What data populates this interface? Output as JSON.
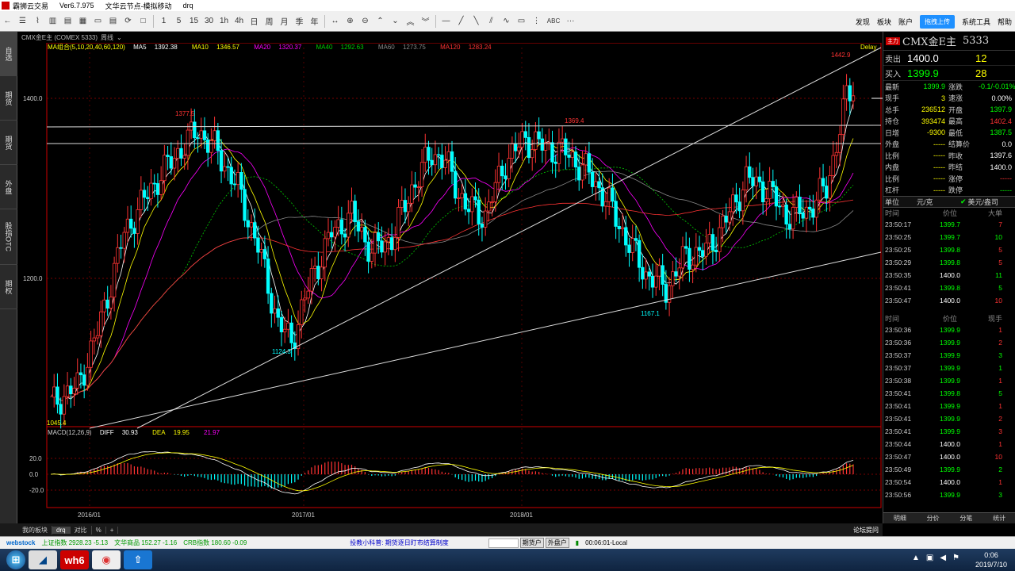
{
  "window": {
    "title": "霸狮云交易",
    "version": "Ver6.7.975",
    "node": "文华云节点-模拟移动",
    "user": "drq"
  },
  "toolbar": {
    "nums": [
      "1",
      "5",
      "15",
      "30",
      "1h",
      "4h",
      "日",
      "周",
      "月",
      "季",
      "年"
    ],
    "abc_label": "ABC",
    "more": "···"
  },
  "topmenu": {
    "items": [
      "发现",
      "板块",
      "账户",
      "系统工具",
      "帮助"
    ],
    "cloud": "拖拽上传"
  },
  "lefttabs": [
    "自选",
    "期货",
    "期货",
    "外盘",
    "股指OTC",
    "期权"
  ],
  "chart": {
    "instrument": "CMX金E主 (COMEX 5333)",
    "period": "周线",
    "ma_label": "MA组合(5,10,20,40,60,120)",
    "ma": [
      {
        "name": "MA5",
        "value": "1392.38",
        "color": "#ffffff"
      },
      {
        "name": "MA10",
        "value": "1346.57",
        "color": "#ffff00"
      },
      {
        "name": "MA20",
        "value": "1320.37",
        "color": "#ff00ff"
      },
      {
        "name": "MA40",
        "value": "1292.63",
        "color": "#00cc00"
      },
      {
        "name": "MA60",
        "value": "1273.75",
        "color": "#888888"
      },
      {
        "name": "MA120",
        "value": "1283.24",
        "color": "#ff3333"
      }
    ],
    "macd_label": "MACD(12,26,9)",
    "macd": [
      {
        "name": "DIFF",
        "value": "30.93"
      },
      {
        "name": "DEA",
        "value": "19.95"
      },
      {
        "name": "",
        "value": "21.97"
      }
    ],
    "annotations": {
      "high_right": "1442.9",
      "peak_2016": "1377.5",
      "peak_2018": "1369.4",
      "low_2016": "1124.3",
      "low_2018": "1167.1",
      "start_low": "1045.4",
      "delay": "Delay"
    },
    "y_labels": [
      "1400.0",
      "1200.0"
    ],
    "macd_y_labels": [
      "20.0",
      "0.0",
      "-20.0"
    ],
    "x_labels": [
      "2016/01",
      "2017/01",
      "2018/01"
    ],
    "colors": {
      "up": "#ff3333",
      "down": "#00ffff",
      "bg": "#000000"
    }
  },
  "quote": {
    "badge": "主力",
    "name": "CMX金E主",
    "code": "5333",
    "sell": {
      "label": "卖出",
      "price": "1400.0",
      "vol": "12"
    },
    "buy": {
      "label": "买入",
      "price": "1399.9",
      "vol": "28"
    },
    "rows": [
      {
        "l1": "最新",
        "v1": "1399.9",
        "c1": "#00ff00",
        "l2": "涨跌",
        "v2": "-0.1/-0.01%",
        "c2": "#00ff00"
      },
      {
        "l1": "现手",
        "v1": "3",
        "c1": "#ffff00",
        "l2": "速涨",
        "v2": "0.00%",
        "c2": "#ffffff"
      },
      {
        "l1": "总手",
        "v1": "236512",
        "c1": "#ffff00",
        "l2": "开盘",
        "v2": "1397.9",
        "c2": "#00ff00"
      },
      {
        "l1": "持仓",
        "v1": "393474",
        "c1": "#ffff00",
        "l2": "最高",
        "v2": "1402.4",
        "c2": "#ff3333"
      },
      {
        "l1": "日增",
        "v1": "-9300",
        "c1": "#ffff00",
        "l2": "最低",
        "v2": "1387.5",
        "c2": "#00ff00"
      },
      {
        "l1": "外盘",
        "v1": "-----",
        "c1": "#ffff00",
        "l2": "结算价",
        "v2": "0.0",
        "c2": "#ffffff"
      },
      {
        "l1": "比例",
        "v1": "-----",
        "c1": "#ffff00",
        "l2": "昨收",
        "v2": "1397.6",
        "c2": "#ffffff"
      },
      {
        "l1": "内盘",
        "v1": "-----",
        "c1": "#ffff00",
        "l2": "昨结",
        "v2": "1400.0",
        "c2": "#ffffff"
      },
      {
        "l1": "比例",
        "v1": "-----",
        "c1": "#ffff00",
        "l2": "涨停",
        "v2": "-----",
        "c2": "#ff3333"
      },
      {
        "l1": "杠杆",
        "v1": "-----",
        "c1": "#ffff00",
        "l2": "跌停",
        "v2": "-----",
        "c2": "#00ff00"
      }
    ],
    "unit": {
      "label": "单位",
      "value": "元/克",
      "alt": "美元/盎司"
    },
    "ticks1_head": [
      "时间",
      "价位",
      "大单"
    ],
    "ticks1": [
      {
        "t": "23:50:17",
        "p": "1399.7",
        "pc": "#00ff00",
        "v": "7",
        "vc": "#ff3333"
      },
      {
        "t": "23:50:25",
        "p": "1399.7",
        "pc": "#00ff00",
        "v": "10",
        "vc": "#00ff00"
      },
      {
        "t": "23:50:25",
        "p": "1399.8",
        "pc": "#00ff00",
        "v": "5",
        "vc": "#ff3333"
      },
      {
        "t": "23:50:29",
        "p": "1399.8",
        "pc": "#00ff00",
        "v": "5",
        "vc": "#ff3333"
      },
      {
        "t": "23:50:35",
        "p": "1400.0",
        "pc": "#ffffff",
        "v": "11",
        "vc": "#00ff00"
      },
      {
        "t": "23:50:41",
        "p": "1399.8",
        "pc": "#00ff00",
        "v": "5",
        "vc": "#00ff00"
      },
      {
        "t": "23:50:47",
        "p": "1400.0",
        "pc": "#ffffff",
        "v": "10",
        "vc": "#ff3333"
      }
    ],
    "ticks2_head": [
      "时间",
      "价位",
      "现手"
    ],
    "ticks2": [
      {
        "t": "23:50:36",
        "p": "1399.9",
        "pc": "#00ff00",
        "v": "1",
        "vc": "#ff3333"
      },
      {
        "t": "23:50:36",
        "p": "1399.9",
        "pc": "#00ff00",
        "v": "2",
        "vc": "#ff3333"
      },
      {
        "t": "23:50:37",
        "p": "1399.9",
        "pc": "#00ff00",
        "v": "3",
        "vc": "#00ff00"
      },
      {
        "t": "23:50:37",
        "p": "1399.9",
        "pc": "#00ff00",
        "v": "1",
        "vc": "#00ff00"
      },
      {
        "t": "23:50:38",
        "p": "1399.9",
        "pc": "#00ff00",
        "v": "1",
        "vc": "#ff3333"
      },
      {
        "t": "23:50:41",
        "p": "1399.8",
        "pc": "#00ff00",
        "v": "5",
        "vc": "#00ff00"
      },
      {
        "t": "23:50:41",
        "p": "1399.9",
        "pc": "#00ff00",
        "v": "1",
        "vc": "#ff3333"
      },
      {
        "t": "23:50:41",
        "p": "1399.9",
        "pc": "#00ff00",
        "v": "2",
        "vc": "#ff3333"
      },
      {
        "t": "23:50:41",
        "p": "1399.9",
        "pc": "#00ff00",
        "v": "3",
        "vc": "#ff3333"
      },
      {
        "t": "23:50:44",
        "p": "1400.0",
        "pc": "#ffffff",
        "v": "1",
        "vc": "#ff3333"
      },
      {
        "t": "23:50:47",
        "p": "1400.0",
        "pc": "#ffffff",
        "v": "10",
        "vc": "#ff3333"
      },
      {
        "t": "23:50:49",
        "p": "1399.9",
        "pc": "#00ff00",
        "v": "2",
        "vc": "#00ff00"
      },
      {
        "t": "23:50:54",
        "p": "1400.0",
        "pc": "#ffffff",
        "v": "1",
        "vc": "#ff3333"
      },
      {
        "t": "23:50:56",
        "p": "1399.9",
        "pc": "#00ff00",
        "v": "3",
        "vc": "#00ff00"
      }
    ],
    "tabs": [
      "明细",
      "分价",
      "分笔",
      "统计"
    ]
  },
  "bottomtabs": [
    "我的板块",
    "drq",
    "对比",
    "%",
    "+"
  ],
  "rightbottom": "论坛提问",
  "status": {
    "sh": "上证指数 2928.23 -5.13",
    "wh": "文华商品 152.27 -1.16",
    "crb": "CRB指数 180.60 -0.09",
    "notice": "投教小科普: 期货逐日盯市结算制度",
    "btn1": "期货户",
    "btn2": "外盘户",
    "time": "00:06:01-Local"
  },
  "taskbar": {
    "time": "0:06",
    "date": "2019/7/10"
  }
}
